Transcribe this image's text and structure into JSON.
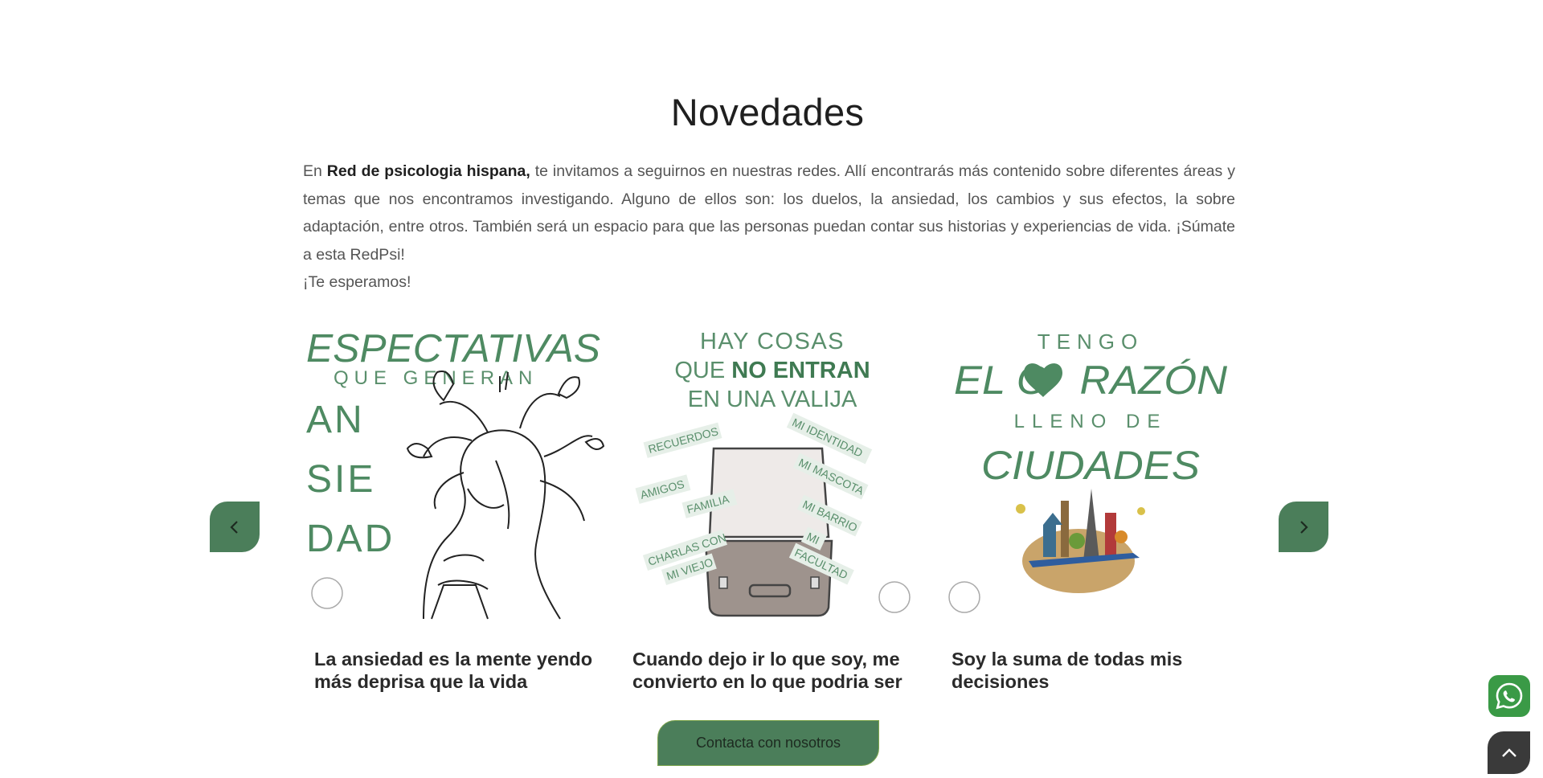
{
  "section": {
    "title": "Novedades",
    "intro": {
      "prefix": "En ",
      "brand": "Red de psicologia hispana,",
      "body": " te invitamos a seguirnos en nuestras redes. Allí encontrarás más contenido sobre diferentes áreas y temas que nos encontramos investigando. Alguno de ellos son: los duelos, la ansiedad, los cambios y sus efectos, la sobre adaptación, entre otros. También será un espacio para que las personas puedan contar sus historias y experiencias de vida. ¡Súmate a esta RedPsi!",
      "closing": "¡Te esperamos!"
    }
  },
  "slider": {
    "prev_icon": "chevron-left-icon",
    "next_icon": "chevron-right-icon",
    "cards": [
      {
        "title": "La ansiedad es la mente yendo más deprisa que la vida",
        "art": {
          "line1": "ESPECTATIVAS",
          "line2": "QUE GENERAN",
          "line3": "AN",
          "line4": "SIE",
          "line5": "DAD"
        }
      },
      {
        "title": "Cuando dejo ir lo que soy, me convierto en lo que podria ser",
        "art": {
          "line1": "HAY COSAS",
          "line2a": "QUE ",
          "line2b": "NO ENTRAN",
          "line3": "EN UNA VALIJA",
          "tags": [
            "RECUERDOS",
            "MI IDENTIDAD",
            "MI MASCOTA",
            "AMIGOS",
            "FAMILIA",
            "MI BARRIO",
            "CHARLAS CON",
            "MI VIEJO",
            "MI",
            "FACULTAD"
          ]
        }
      },
      {
        "title": "Soy la suma de todas mis decisiones",
        "art": {
          "line1": "TENGO",
          "line2a": "EL C",
          "line2b": "RAZÓN",
          "line3": "LLENO DE",
          "line4": "CIUDADES"
        }
      }
    ]
  },
  "contact_button": {
    "label": "Contacta con nosotros"
  },
  "floating": {
    "whatsapp_icon": "whatsapp-icon",
    "back_to_top_icon": "chevron-up-icon"
  },
  "colors": {
    "brand_green": "#4b7e5a",
    "art_green": "#4e8a62",
    "whatsapp": "#3a9a46",
    "dark": "#3a3a3a"
  }
}
